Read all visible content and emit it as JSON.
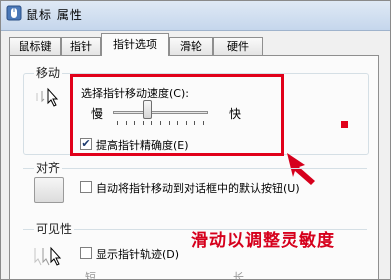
{
  "window": {
    "title": "鼠标 属性"
  },
  "tabs": [
    {
      "label": "鼠标键"
    },
    {
      "label": "指针"
    },
    {
      "label": "指针选项"
    },
    {
      "label": "滑轮"
    },
    {
      "label": "硬件"
    }
  ],
  "sections": {
    "motion": {
      "title": "移动",
      "speed_label": "选择指针移动速度(C):",
      "slow_label": "慢",
      "fast_label": "快",
      "speed_value_fraction": 0.35,
      "precision_label": "提高指针精确度(E)",
      "precision_checked": true
    },
    "snap": {
      "title": "对齐",
      "label": "自动将指针移动到对话框中的默认按钮(U)",
      "checked": false
    },
    "visibility": {
      "title": "可见性",
      "trails_label": "显示指针轨迹(D)",
      "trails_checked": false,
      "short_label": "短",
      "long_label": "长"
    }
  },
  "annotation": {
    "text": "滑动以调整灵敏度",
    "color": "#d6001c"
  },
  "colors": {
    "highlight_red": "#e1001a"
  }
}
